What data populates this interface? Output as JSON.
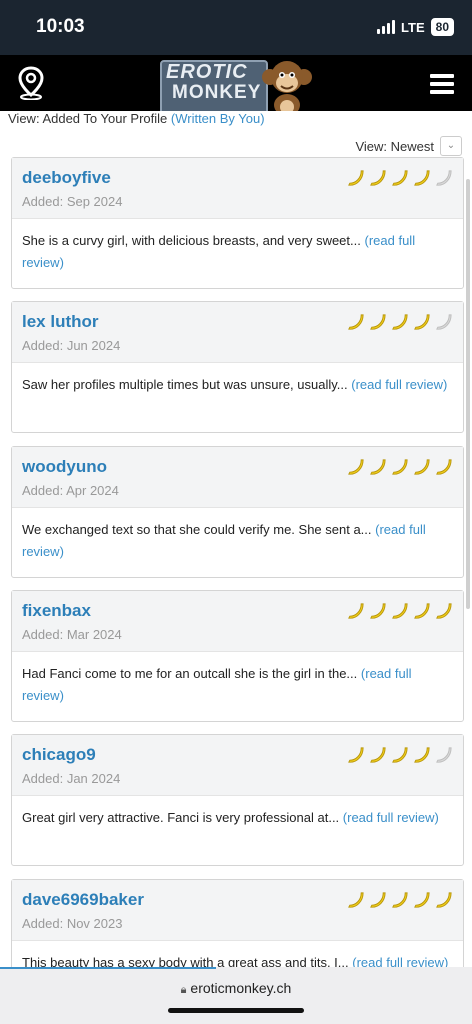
{
  "status_bar": {
    "time": "10:03",
    "network": "LTE",
    "battery": "80"
  },
  "header": {
    "logo_line1": "EROTIC",
    "logo_line2": "MONKEY"
  },
  "view_line": {
    "text": "View: Added To Your Profile",
    "link": "(Written By You)"
  },
  "sort": {
    "label": "View: Newest"
  },
  "reviews": [
    {
      "name": "deeboyfive",
      "date": "Added: Sep 2024",
      "snippet": "She is a curvy girl, with delicious breasts, and very sweet...",
      "link": "(read full review)",
      "rating": 4
    },
    {
      "name": "lex luthor",
      "date": "Added: Jun 2024",
      "snippet": "Saw her profiles multiple times but was unsure, usually...",
      "link": "(read full review)",
      "rating": 4
    },
    {
      "name": "woodyuno",
      "date": "Added: Apr 2024",
      "snippet": "We exchanged text so that she could verify me. She sent a...",
      "link": "(read full review)",
      "rating": 5
    },
    {
      "name": "fixenbax",
      "date": "Added: Mar 2024",
      "snippet": "Had Fanci come to me for an outcall she is the girl in the...",
      "link": "(read full review)",
      "rating": 5
    },
    {
      "name": "chicago9",
      "date": "Added: Jan 2024",
      "snippet": "Great girl very attractive. Fanci is very professional at...",
      "link": "(read full review)",
      "rating": 4
    },
    {
      "name": "dave6969baker",
      "date": "Added: Nov 2023",
      "snippet": "This beauty has a sexy body with a great ass and tits. I...",
      "link": "(read full review)",
      "rating": 5
    }
  ],
  "browser": {
    "url": "eroticmonkey.ch"
  },
  "colors": {
    "banana": "#f2d01b",
    "banana_empty": "#d9d9d9",
    "link": "#3a8fc9",
    "name": "#2d7fb8"
  }
}
